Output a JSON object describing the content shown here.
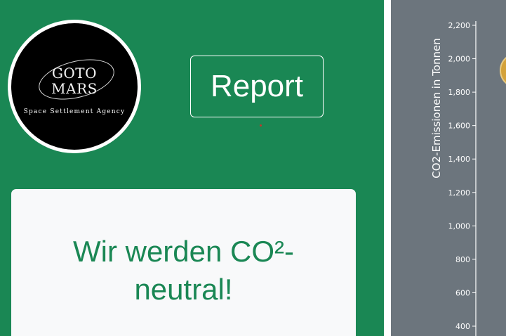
{
  "logo": {
    "line1": "GOTO",
    "line2": "MARS",
    "tagline": "Space Settlement Agency"
  },
  "report_button": {
    "label": "Report"
  },
  "headline": {
    "text": "Wir werden CO²-neutral!"
  },
  "colors": {
    "brand_green": "#1a8754",
    "chart_background": "#6c757d",
    "card_background": "#f8f9fa",
    "marker_gold": "#d4a23a"
  },
  "chart_data": {
    "type": "scatter",
    "ylabel": "CO2-Emissionen in Tonnen",
    "yticks": [
      400,
      600,
      800,
      1000,
      1200,
      1400,
      1600,
      1800,
      2000,
      2200
    ],
    "ytick_labels": [
      "400",
      "600",
      "800",
      "1,000",
      "1,200",
      "1,400",
      "1,600",
      "1,800",
      "2,000",
      "2,200"
    ],
    "ylim": [
      200,
      2200
    ],
    "grid": false,
    "series": [
      {
        "values": [
          1930
        ]
      }
    ]
  }
}
